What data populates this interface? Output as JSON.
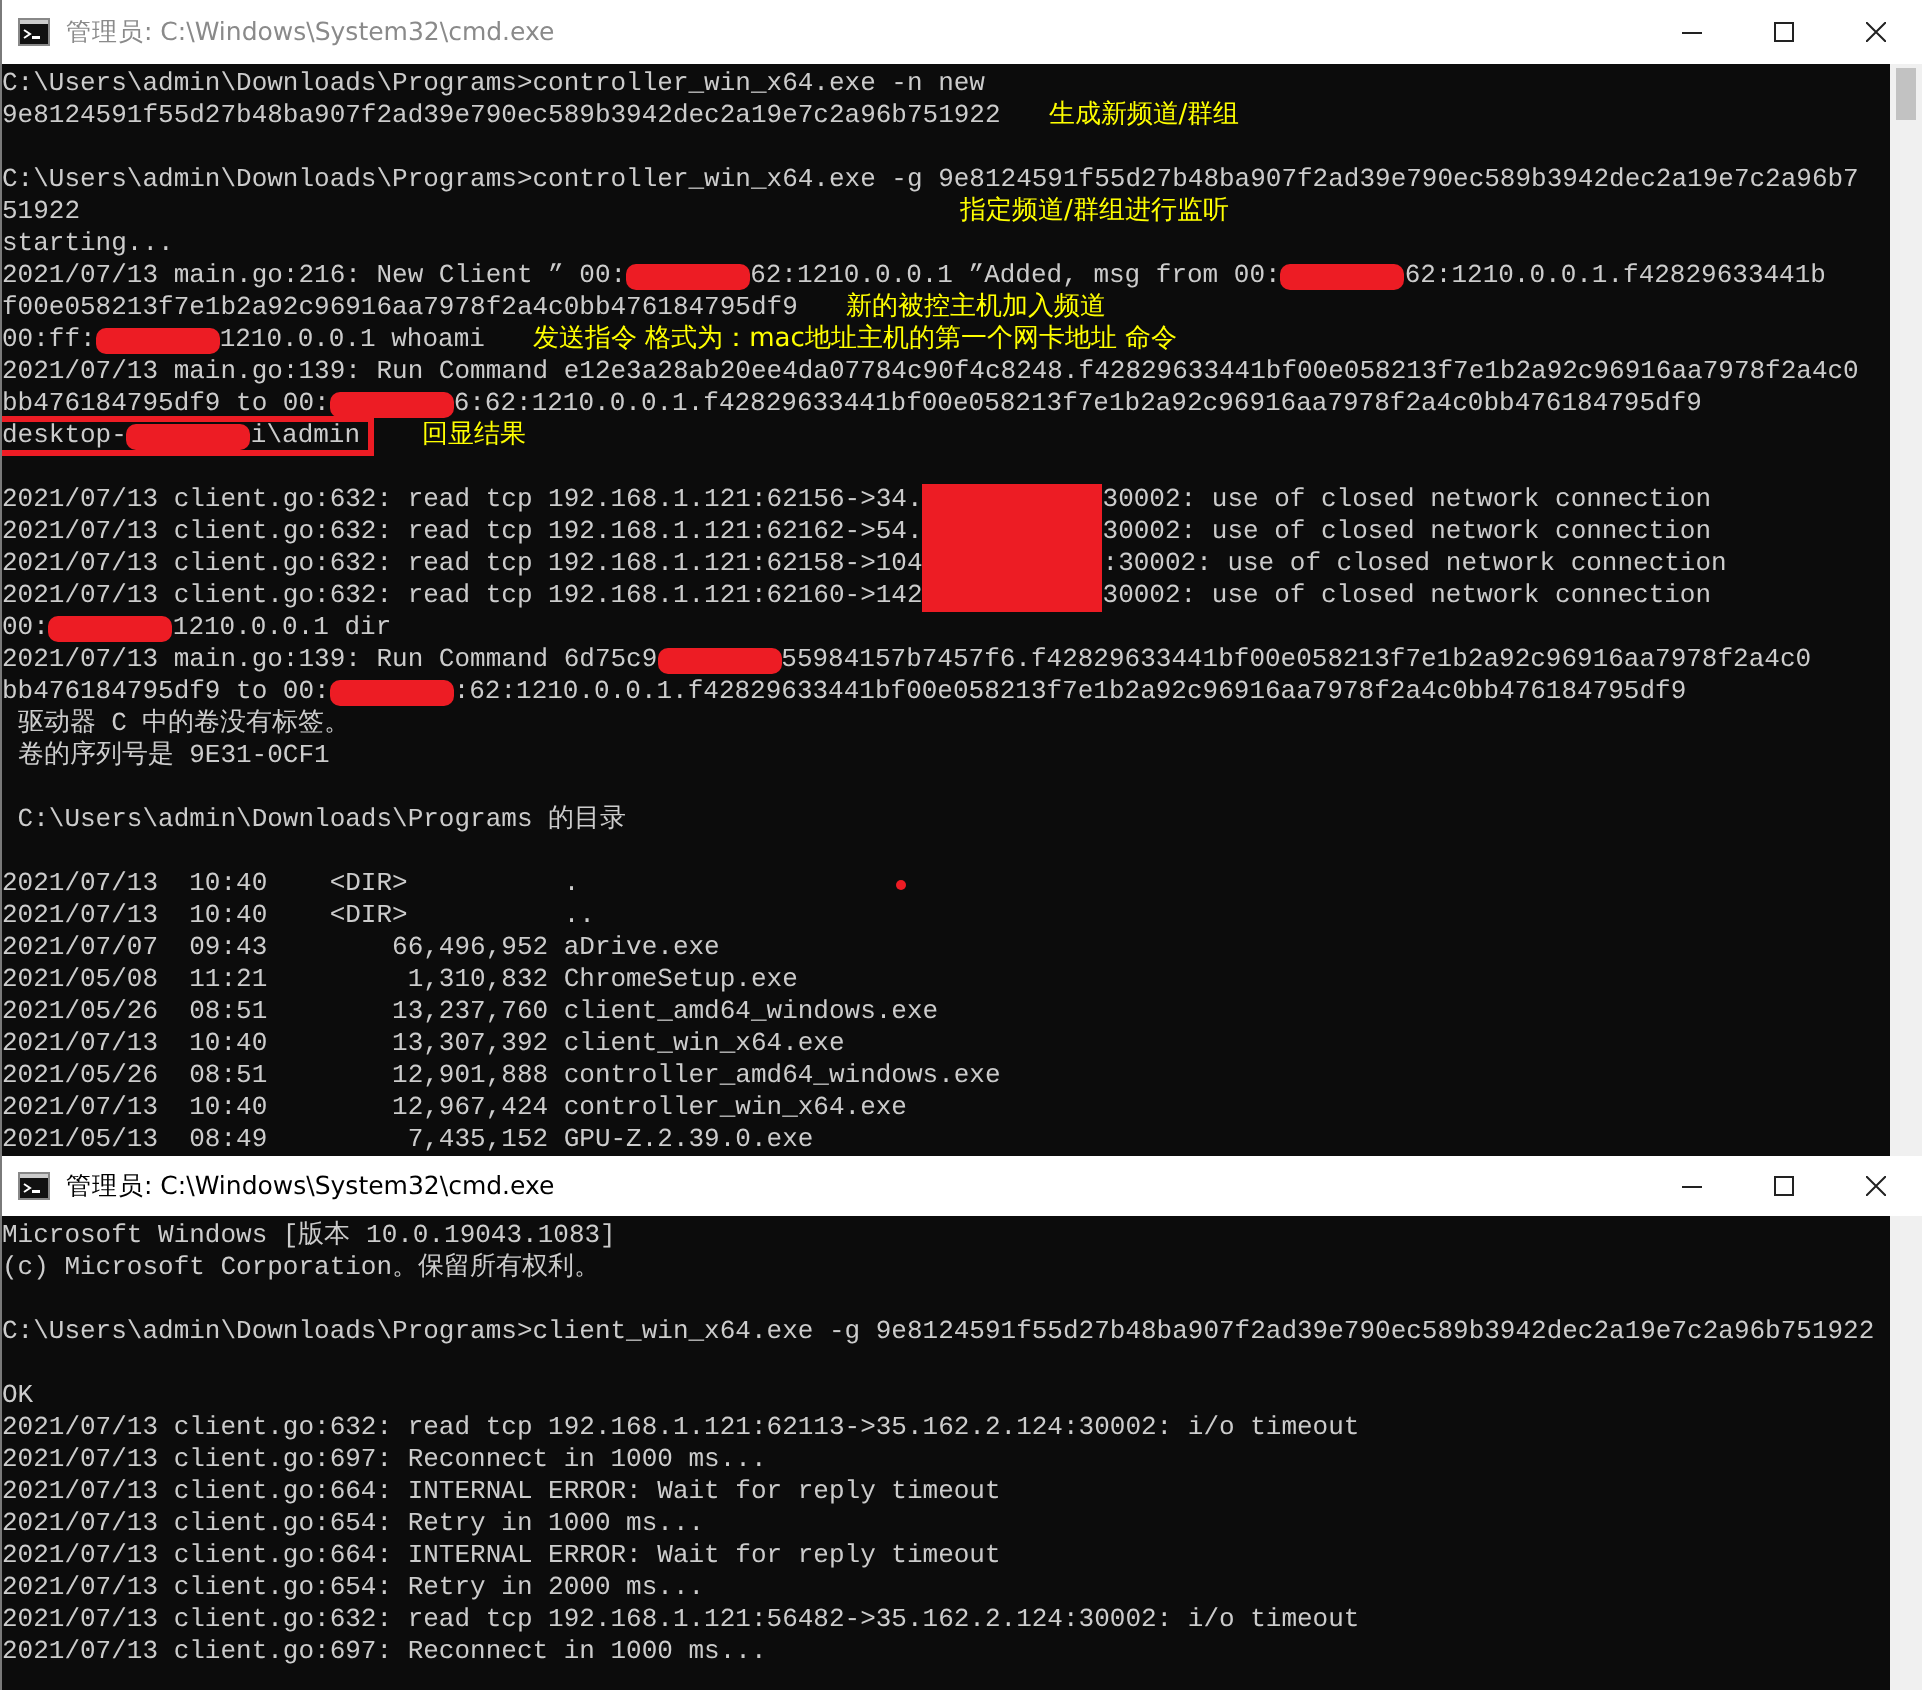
{
  "windows": [
    {
      "title": "管理员: C:\\Windows\\System32\\cmd.exe",
      "active": false,
      "lines": [
        {
          "segments": [
            {
              "kind": "text",
              "text": "C:\\Users\\admin\\Downloads\\Programs>controller_win_x64.exe -n new"
            }
          ]
        },
        {
          "segments": [
            {
              "kind": "text",
              "text": "9e8124591f55d27b48ba907f2ad39e790ec589b3942dec2a19e7c2a96b751922"
            },
            {
              "kind": "note",
              "text": "生成新频道/群组"
            }
          ]
        },
        {
          "kind": "blank"
        },
        {
          "segments": [
            {
              "kind": "text",
              "text": "C:\\Users\\admin\\Downloads\\Programs>controller_win_x64.exe -g 9e8124591f55d27b48ba907f2ad39e790ec589b3942dec2a19e7c2a96b7"
            }
          ]
        },
        {
          "segments": [
            {
              "kind": "text",
              "text": "51922"
            },
            {
              "kind": "callout",
              "text": "指定频道/群组进行监听"
            }
          ]
        },
        {
          "segments": [
            {
              "kind": "text",
              "text": "starting..."
            }
          ]
        },
        {
          "segments": [
            {
              "kind": "text",
              "text": "2021/07/13 main.go:216: New Client ” 00:"
            },
            {
              "kind": "redaction"
            },
            {
              "kind": "text",
              "text": "62:1210.0.0.1 ”Added, msg from 00:"
            },
            {
              "kind": "redaction"
            },
            {
              "kind": "text",
              "text": "62:1210.0.0.1.f42829633441b"
            }
          ]
        },
        {
          "segments": [
            {
              "kind": "text",
              "text": "f00e058213f7e1b2a92c96916aa7978f2a4c0bb476184795df9"
            },
            {
              "kind": "note",
              "text": "新的被控主机加入频道"
            }
          ]
        },
        {
          "segments": [
            {
              "kind": "text",
              "text": "00:ff:"
            },
            {
              "kind": "redaction"
            },
            {
              "kind": "text",
              "text": "1210.0.0.1 whoami"
            },
            {
              "kind": "note",
              "text": "发送指令 格式为：mac地址主机的第一个网卡地址 命令"
            }
          ]
        },
        {
          "segments": [
            {
              "kind": "text",
              "text": "2021/07/13 main.go:139: Run Command e12e3a28ab20ee4da07784c90f4c8248.f42829633441bf00e058213f7e1b2a92c96916aa7978f2a4c0"
            }
          ]
        },
        {
          "segments": [
            {
              "kind": "text",
              "text": "bb476184795df9 to 00:"
            },
            {
              "kind": "redaction"
            },
            {
              "kind": "text",
              "text": "6:62:1210.0.0.1.f42829633441bf00e058213f7e1b2a92c96916aa7978f2a4c0bb476184795df9"
            }
          ]
        },
        {
          "segments": [
            {
              "kind": "boxed",
              "segments": [
                {
                  "kind": "text",
                  "text": "desktop-"
                },
                {
                  "kind": "redaction"
                },
                {
                  "kind": "text",
                  "text": "i\\admin"
                }
              ]
            },
            {
              "kind": "note",
              "text": "回显结果"
            }
          ]
        },
        {
          "kind": "blank"
        },
        {
          "segments": [
            {
              "kind": "text",
              "text": "2021/07/13 client.go:632: read tcp 192.168.1.121:62156->34."
            },
            {
              "kind": "block"
            },
            {
              "kind": "text",
              "text": "30002: use of closed network connection"
            }
          ]
        },
        {
          "segments": [
            {
              "kind": "text",
              "text": "2021/07/13 client.go:632: read tcp 192.168.1.121:62162->54."
            },
            {
              "kind": "block"
            },
            {
              "kind": "text",
              "text": "30002: use of closed network connection"
            }
          ]
        },
        {
          "segments": [
            {
              "kind": "text",
              "text": "2021/07/13 client.go:632: read tcp 192.168.1.121:62158->104"
            },
            {
              "kind": "block"
            },
            {
              "kind": "text",
              "text": ":30002: use of closed network connection"
            }
          ]
        },
        {
          "segments": [
            {
              "kind": "text",
              "text": "2021/07/13 client.go:632: read tcp 192.168.1.121:62160->142"
            },
            {
              "kind": "block"
            },
            {
              "kind": "text",
              "text": "30002: use of closed network connection"
            }
          ]
        },
        {
          "segments": [
            {
              "kind": "text",
              "text": "00:"
            },
            {
              "kind": "redaction"
            },
            {
              "kind": "text",
              "text": "1210.0.0.1 dir"
            }
          ]
        },
        {
          "segments": [
            {
              "kind": "text",
              "text": "2021/07/13 main.go:139: Run Command 6d75c9"
            },
            {
              "kind": "redaction"
            },
            {
              "kind": "text",
              "text": "55984157b7457f6.f42829633441bf00e058213f7e1b2a92c96916aa7978f2a4c0"
            }
          ]
        },
        {
          "segments": [
            {
              "kind": "text",
              "text": "bb476184795df9 to 00:"
            },
            {
              "kind": "redaction"
            },
            {
              "kind": "text",
              "text": ":62:1210.0.0.1.f42829633441bf00e058213f7e1b2a92c96916aa7978f2a4c0bb476184795df9"
            }
          ]
        },
        {
          "segments": [
            {
              "kind": "text",
              "text": " 驱动器 C 中的卷没有标签。"
            }
          ]
        },
        {
          "segments": [
            {
              "kind": "text",
              "text": " 卷的序列号是 9E31-0CF1"
            }
          ]
        },
        {
          "kind": "blank"
        },
        {
          "segments": [
            {
              "kind": "text",
              "text": " C:\\Users\\admin\\Downloads\\Programs 的目录"
            }
          ]
        },
        {
          "kind": "blank"
        },
        {
          "segments": [
            {
              "kind": "text",
              "text": "2021/07/13  10:40    <DIR>          ."
            },
            {
              "kind": "dot"
            }
          ]
        },
        {
          "segments": [
            {
              "kind": "text",
              "text": "2021/07/13  10:40    <DIR>          .."
            }
          ]
        },
        {
          "segments": [
            {
              "kind": "text",
              "text": "2021/07/07  09:43        66,496,952 aDrive.exe"
            }
          ]
        },
        {
          "segments": [
            {
              "kind": "text",
              "text": "2021/05/08  11:21         1,310,832 ChromeSetup.exe"
            }
          ]
        },
        {
          "segments": [
            {
              "kind": "text",
              "text": "2021/05/26  08:51        13,237,760 client_amd64_windows.exe"
            }
          ]
        },
        {
          "segments": [
            {
              "kind": "text",
              "text": "2021/07/13  10:40        13,307,392 client_win_x64.exe"
            }
          ]
        },
        {
          "segments": [
            {
              "kind": "text",
              "text": "2021/05/26  08:51        12,901,888 controller_amd64_windows.exe"
            }
          ]
        },
        {
          "segments": [
            {
              "kind": "text",
              "text": "2021/07/13  10:40        12,967,424 controller_win_x64.exe"
            }
          ]
        },
        {
          "segments": [
            {
              "kind": "text",
              "text": "2021/05/13  08:49         7,435,152 GPU-Z.2.39.0.exe"
            }
          ]
        }
      ]
    },
    {
      "title": "管理员: C:\\Windows\\System32\\cmd.exe",
      "active": true,
      "lines": [
        {
          "segments": [
            {
              "kind": "text",
              "text": "Microsoft Windows [版本 10.0.19043.1083]"
            }
          ]
        },
        {
          "segments": [
            {
              "kind": "text",
              "text": "(c) Microsoft Corporation。保留所有权利。"
            }
          ]
        },
        {
          "kind": "blank"
        },
        {
          "segments": [
            {
              "kind": "text",
              "text": "C:\\Users\\admin\\Downloads\\Programs>client_win_x64.exe -g 9e8124591f55d27b48ba907f2ad39e790ec589b3942dec2a19e7c2a96b751922"
            }
          ]
        },
        {
          "kind": "blank"
        },
        {
          "segments": [
            {
              "kind": "text",
              "text": "OK"
            }
          ]
        },
        {
          "segments": [
            {
              "kind": "text",
              "text": "2021/07/13 client.go:632: read tcp 192.168.1.121:62113->35.162.2.124:30002: i/o timeout"
            }
          ]
        },
        {
          "segments": [
            {
              "kind": "text",
              "text": "2021/07/13 client.go:697: Reconnect in 1000 ms..."
            }
          ]
        },
        {
          "segments": [
            {
              "kind": "text",
              "text": "2021/07/13 client.go:664: INTERNAL ERROR: Wait for reply timeout"
            }
          ]
        },
        {
          "segments": [
            {
              "kind": "text",
              "text": "2021/07/13 client.go:654: Retry in 1000 ms..."
            }
          ]
        },
        {
          "segments": [
            {
              "kind": "text",
              "text": "2021/07/13 client.go:664: INTERNAL ERROR: Wait for reply timeout"
            }
          ]
        },
        {
          "segments": [
            {
              "kind": "text",
              "text": "2021/07/13 client.go:654: Retry in 2000 ms..."
            }
          ]
        },
        {
          "segments": [
            {
              "kind": "text",
              "text": "2021/07/13 client.go:632: read tcp 192.168.1.121:56482->35.162.2.124:30002: i/o timeout"
            }
          ]
        },
        {
          "segments": [
            {
              "kind": "text",
              "text": "2021/07/13 client.go:697: Reconnect in 1000 ms..."
            }
          ]
        }
      ]
    }
  ]
}
